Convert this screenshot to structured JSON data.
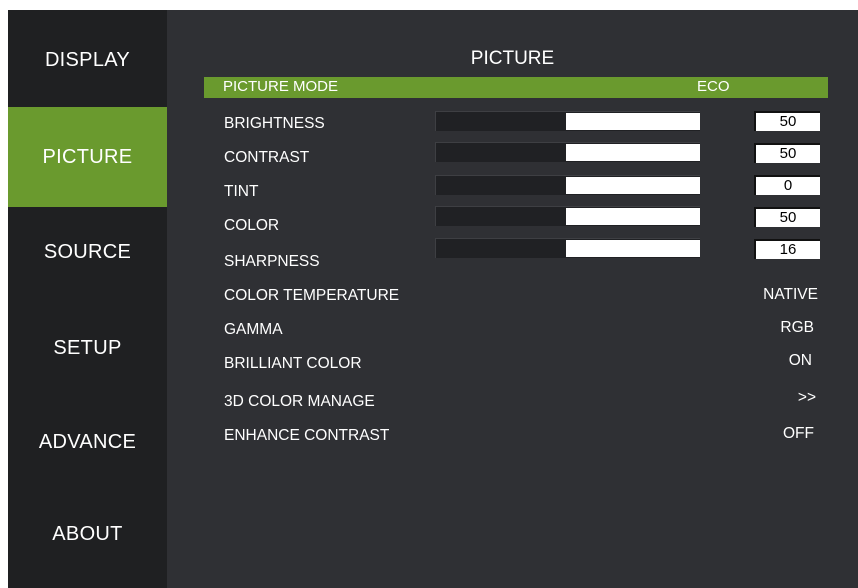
{
  "sidebar": {
    "items": [
      {
        "label": "DISPLAY",
        "active": false
      },
      {
        "label": "PICTURE",
        "active": true
      },
      {
        "label": "SOURCE",
        "active": false
      },
      {
        "label": "SETUP",
        "active": false
      },
      {
        "label": "ADVANCE",
        "active": false
      },
      {
        "label": "ABOUT",
        "active": false
      }
    ]
  },
  "menu": {
    "title": "PICTURE",
    "picture_mode": {
      "label": "PICTURE MODE",
      "value": "ECO"
    },
    "sliders": [
      {
        "label": "BRIGHTNESS",
        "value": "50"
      },
      {
        "label": "CONTRAST",
        "value": "50"
      },
      {
        "label": "TINT",
        "value": "0"
      },
      {
        "label": "COLOR",
        "value": "50"
      },
      {
        "label": "SHARPNESS",
        "value": "16"
      }
    ],
    "options": [
      {
        "label": "COLOR TEMPERATURE",
        "value": "NATIVE"
      },
      {
        "label": "GAMMA",
        "value": "RGB"
      },
      {
        "label": "BRILLIANT COLOR",
        "value": "ON"
      },
      {
        "label": "3D COLOR MANAGE",
        "value": ">>"
      },
      {
        "label": "ENHANCE CONTRAST",
        "value": "OFF"
      }
    ]
  },
  "colors": {
    "accent": "#6a9a2e",
    "sidebar_bg": "#1f2022",
    "panel_bg": "#2f3034"
  }
}
